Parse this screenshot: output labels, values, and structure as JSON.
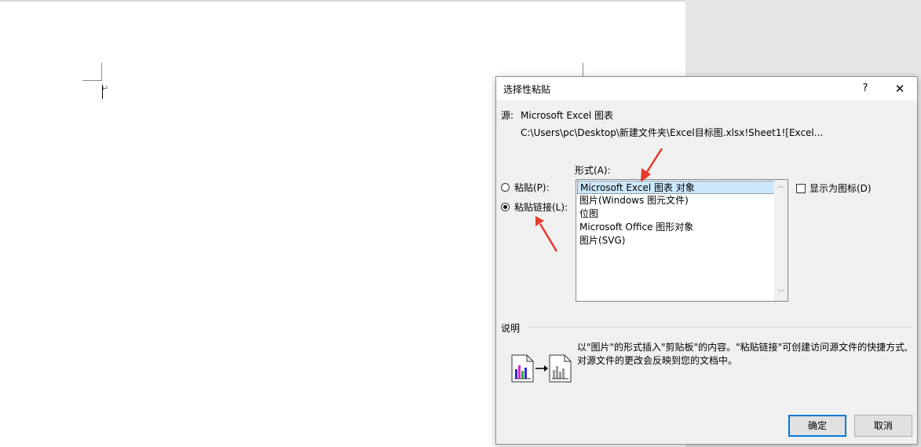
{
  "dialog": {
    "title": "选择性粘贴",
    "help_glyph": "?",
    "close_glyph": "✕",
    "source_label": "源:",
    "source_value": "Microsoft Excel 图表",
    "source_path": "C:\\Users\\pc\\Desktop\\新建文件夹\\Excel目标图.xlsx!Sheet1![Excel...",
    "format_label": "形式(A):",
    "formats": [
      "Microsoft Excel 图表 对象",
      "图片(Windows 图元文件)",
      "位图",
      "Microsoft Office 图形对象",
      "图片(SVG)"
    ],
    "selected_format_index": 0,
    "paste_option": "粘贴(P):",
    "paste_link_option": "粘贴链接(L):",
    "paste_link_checked": true,
    "display_as_icon_label": "显示为图标(D)",
    "display_as_icon_checked": false,
    "description_label": "说明",
    "description_text": "以\"图片\"的形式插入\"剪贴板\"的内容。\"粘贴链接\"可创建访问源文件的快捷方式,对源文件的更改会反映到您的文档中。",
    "ok_label": "确定",
    "cancel_label": "取消"
  },
  "colors": {
    "selection": "#cce8ff",
    "focus_border": "#0078d7",
    "annotation_arrow": "#e8392e"
  },
  "icons": [
    "paragraph-mark-icon",
    "question-icon",
    "close-icon",
    "scroll-up-icon",
    "scroll-down-icon",
    "chart-source-icon",
    "arrow-right-icon",
    "chart-link-icon",
    "annotation-arrow-icon"
  ]
}
